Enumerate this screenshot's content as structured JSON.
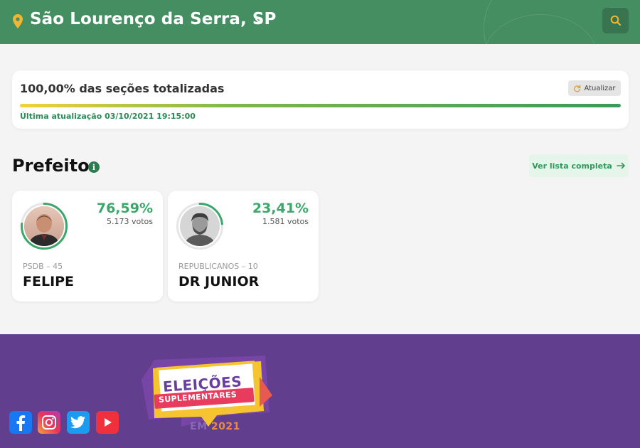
{
  "header": {
    "city": "São Lourenço da Serra, SP",
    "icons": {
      "location": "location-pin-icon",
      "dropdown": "chevron-down-icon",
      "search": "search-icon"
    },
    "colors": {
      "bar": "#458e62",
      "pin": "#f2b632"
    }
  },
  "progress": {
    "title": "100,00% das seções totalizadas",
    "refresh_label": "Atualizar",
    "percent": 100,
    "updated": "Última atualização 03/10/2021 19:15:00"
  },
  "section": {
    "title": "Prefeito",
    "full_list_label": "Ver lista completa"
  },
  "candidates": [
    {
      "percent": "76,59%",
      "percent_value": 76.59,
      "votes": "5.173 votos",
      "party": "PSDB – 45",
      "name": "FELIPE"
    },
    {
      "percent": "23,41%",
      "percent_value": 23.41,
      "votes": "1.581 votos",
      "party": "REPUBLICANOS – 10",
      "name": "DR JUNIOR"
    }
  ],
  "footer": {
    "social": [
      "facebook-icon",
      "instagram-icon",
      "twitter-icon",
      "youtube-icon"
    ],
    "logo": {
      "word1": "ELEIÇÕES",
      "word2": "SUPLEMENTARES",
      "em": "EM",
      "year": "2021"
    },
    "colors": {
      "background": "#613e8e"
    }
  }
}
